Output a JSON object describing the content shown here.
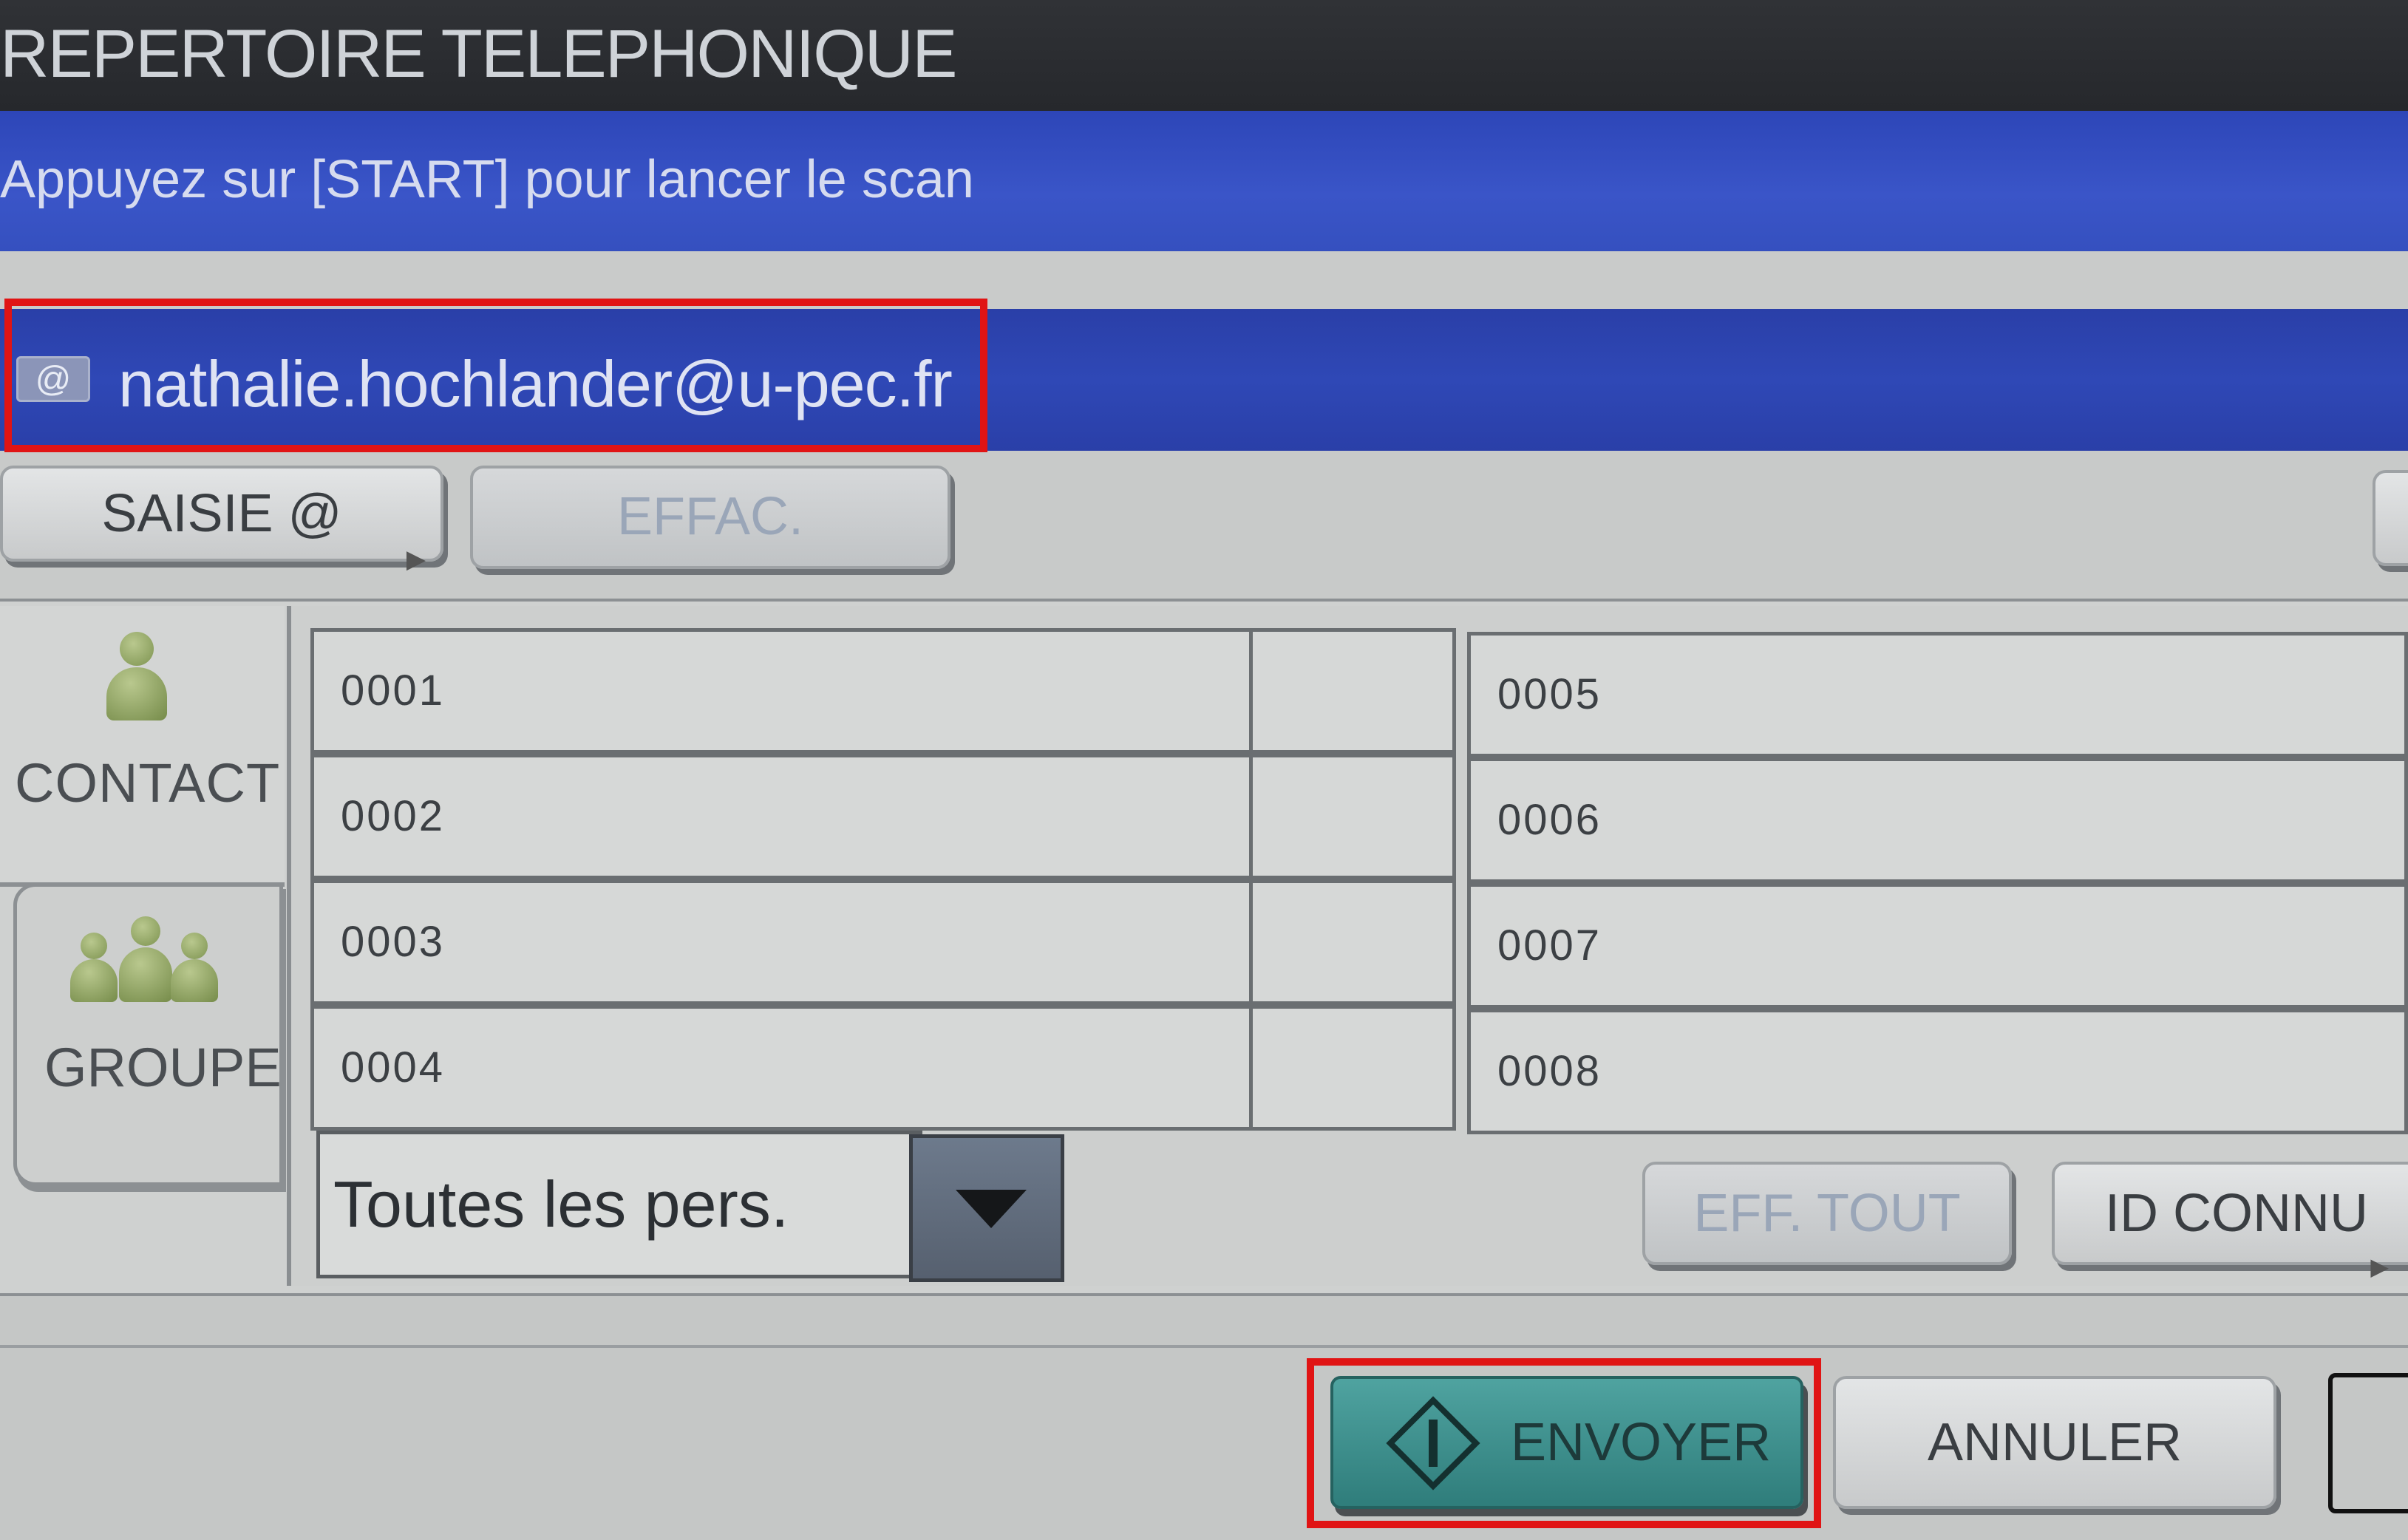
{
  "header": {
    "title": "REPERTOIRE TELEPHONIQUE",
    "message": "Appuyez sur [START] pour lancer le scan"
  },
  "recipient": {
    "email": "nathalie.hochlander@u-pec.fr",
    "icon": "email-icon"
  },
  "toolbar": {
    "saisie_label": "SAISIE @",
    "effac_label": "EFFAC."
  },
  "tabs": {
    "contact": "CONTACT",
    "groupe": "GROUPE"
  },
  "entries": {
    "left": [
      "0001",
      "0002",
      "0003",
      "0004"
    ],
    "right": [
      "0005",
      "0006",
      "0007",
      "0008"
    ]
  },
  "filter": {
    "selected": "Toutes les pers."
  },
  "actions": {
    "eff_tout": "EFF. TOUT",
    "id_connu": "ID CONNU",
    "envoyer": "ENVOYER",
    "annuler": "ANNULER"
  },
  "colors": {
    "title_bar": "#2a2c30",
    "message_bar": "#3550bf",
    "address_bar": "#2f48b6",
    "highlight": "#e01414",
    "send_button": "#3f908e"
  }
}
